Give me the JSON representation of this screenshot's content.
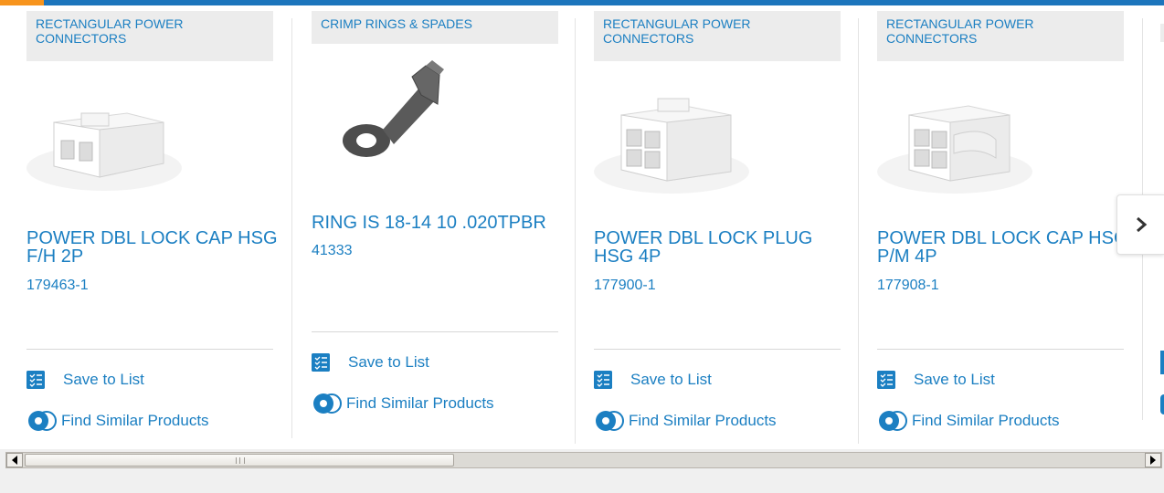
{
  "colors": {
    "brand_blue": "#1b7fc2",
    "accent_orange": "#f7941d",
    "tag_bg": "#ececec"
  },
  "cards": [
    {
      "category": "RECTANGULAR POWER CONNECTORS",
      "title": "POWER DBL LOCK CAP HSG F/H 2P",
      "part_number": "179463-1",
      "image_icon": "connector-2-position-icon"
    },
    {
      "category": "CRIMP RINGS & SPADES",
      "title": "RING IS 18-14 10 .020TPBR",
      "part_number": "41333",
      "image_icon": "ring-terminal-icon"
    },
    {
      "category": "RECTANGULAR POWER CONNECTORS",
      "title": "POWER DBL LOCK PLUG HSG 4P",
      "part_number": "177900-1",
      "image_icon": "connector-4-position-plug-icon"
    },
    {
      "category": "RECTANGULAR POWER CONNECTORS",
      "title": "POWER DBL LOCK CAP HSG P/M 4P",
      "part_number": "177908-1",
      "image_icon": "connector-4-position-cap-icon"
    }
  ],
  "actions": {
    "save_label": "Save to List",
    "similar_label": "Find Similar Products"
  },
  "carousel": {
    "next_icon": "chevron-right-icon"
  },
  "scrollbar": {
    "left_icon": "arrow-left-icon",
    "right_icon": "arrow-right-icon"
  }
}
